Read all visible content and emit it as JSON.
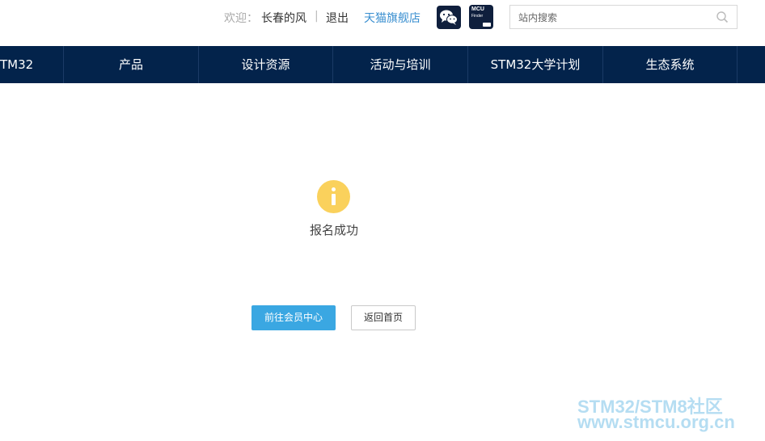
{
  "header": {
    "welcome_label": "欢迎：",
    "username": "长春的风",
    "separator": "|",
    "logout_label": "退出",
    "tmall_label": "天猫旗舰店",
    "mcu_finder": {
      "line1": "MCU",
      "line2": "Finder"
    },
    "search": {
      "placeholder": "站内搜索",
      "value": ""
    }
  },
  "nav": {
    "items": [
      {
        "label": "TM32"
      },
      {
        "label": "产品"
      },
      {
        "label": "设计资源"
      },
      {
        "label": "活动与培训"
      },
      {
        "label": "STM32大学计划"
      },
      {
        "label": "生态系统"
      }
    ]
  },
  "main": {
    "message": "报名成功",
    "primary_button": "前往会员中心",
    "secondary_button": "返回首页"
  },
  "watermark": {
    "line1": "STM32/STM8社区",
    "line2": "www.stmcu.org.cn"
  },
  "colors": {
    "nav_bg": "#03234b",
    "accent": "#3aa7e2",
    "info_icon": "#fad15c",
    "link": "#3a8fd0"
  }
}
